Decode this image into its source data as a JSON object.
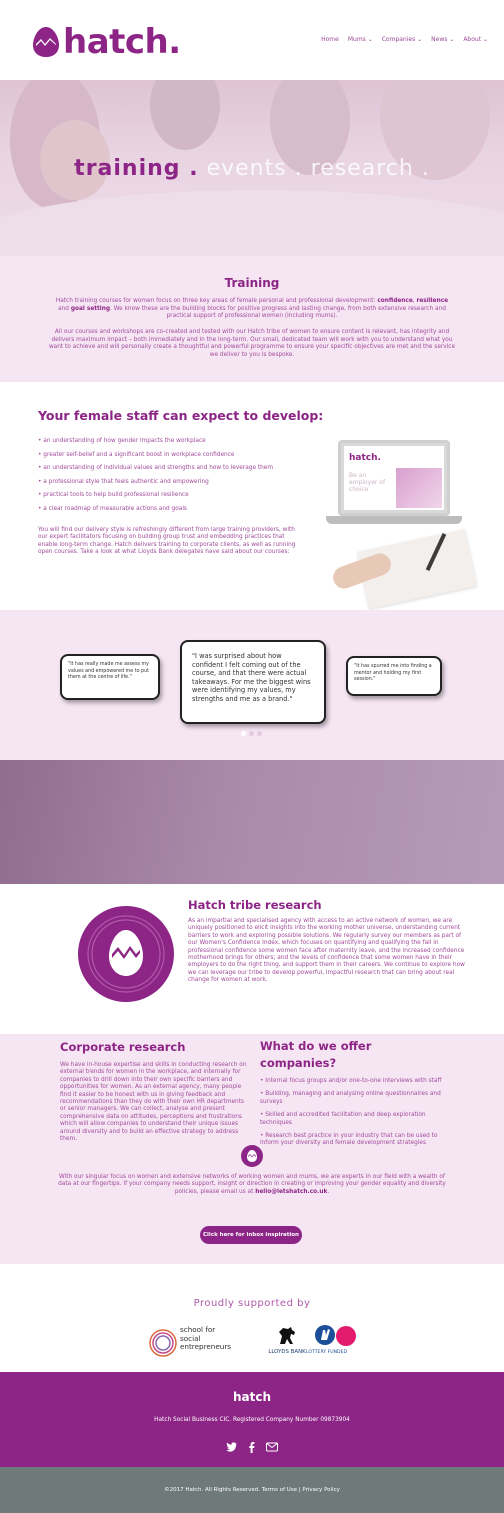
{
  "header": {
    "brand": "hatch.",
    "nav": [
      "Home",
      "Mums ⌄",
      "Companies ⌄",
      "News ⌄",
      "About ⌄"
    ]
  },
  "hero": {
    "word1": "training .",
    "word2": "events . research ."
  },
  "training": {
    "title": "Training",
    "p1_a": "Hatch training courses for women focus on three key areas of female personal and professional development: ",
    "p1_b1": "confidence",
    "p1_c": ", ",
    "p1_b2": "resilience",
    "p1_d": " and ",
    "p1_b3": "goal setting",
    "p1_e": ". We know these are the building blocks for positive progress and lasting change, from both extensive research and practical support of professional women (including mums).",
    "p2": "All our courses and workshops are co-created and tested with our Hatch tribe of women to ensure content is relevant, has integrity and delivers maximum impact – both immediately and in the long-term. Our small, dedicated team will work with you to understand what you want to achieve and will personally create a thoughtful and powerful programme to ensure your specific objectives are met and the service we deliver to you is bespoke."
  },
  "develop": {
    "title": "Your female staff can expect to develop:",
    "items": [
      "• an understanding of how gender impacts the workplace",
      "• greater self-belief and a significant boost in workplace confidence",
      "• an understanding of individual values and strengths and how to leverage them",
      "• a professional style that feels authentic and empowering",
      "• practical tools to help build professional resilience",
      "• a clear roadmap of measurable actions and goals"
    ],
    "paragraph": "You will find our delivery style is refreshingly different from large training providers, with our expert facilitators focusing on building group trust and embedding practices that enable long-term change. Hatch delivers training to corporate clients, as well as running open courses. Take a look at what Lloyds Bank delegates have said about our courses:",
    "laptop_brand": "hatch.",
    "laptop_text": "Be an employer of choice"
  },
  "testimonials": {
    "left": "\"It has really made me assess my values and empowered me to put them at the centre of life.\"",
    "center": "\"I was surprised about how confident I felt coming out of the course, and that there were actual takeaways. For me the biggest wins were identifying my values, my strengths and me as a brand.\"",
    "right": "\"It has spurred me into finding a mentor and holding my first session.\""
  },
  "research": {
    "title": "Hatch tribe research",
    "paragraph": "As an impartial and specialised agency with access to an active network of women, we are uniquely positioned to elicit insights into the working mother universe, understanding current barriers to work and exploring possible solutions. We regularly survey our members as part of our Women's Confidence Index, which focuses on quantifying and qualifying the fall in professional confidence some women face after maternity leave, and the increased confidence motherhood brings for others; and the levels of confidence that some women have in their employers to do the right thing, and support them in their careers. We continue to explore how we can leverage our tribe to develop powerful, impactful research that can bring about real change for women at work."
  },
  "corporate": {
    "title": "Corporate research",
    "paragraph": "We have in-house expertise and skills in conducting research on external trends for women in the workplace, and internally for companies to drill down into their own specific barriers and opportunities for women. As an external agency, many people find it easier to be honest with us in giving feedback and recommendations than they do with their own HR departments or senior managers. We can collect, analyse and present comprehensive data on attitudes, perceptions and frustrations which will allow companies to understand their unique issues around diversity and to build an effective strategy to address them.",
    "offer_title": "What do we offer companies?",
    "offers": [
      "• Internal focus groups and/or one-to-one interviews with staff",
      "• Building, managing and analysing online questionnaires and surveys",
      "• Skilled and accredited facilitation and deep exploration techniques",
      "• Research best practice in your industry that can be used to inform your diversity and female development strategies"
    ],
    "footer_text": "With our singular focus on women and extensive networks of working women and mums, we are experts in our field with a wealth of data at our fingertips. If your company needs support, insight or direction in creating or improving your gender equality and diversity policies, please email us at ",
    "email": "hello@letshatch.co.uk",
    "footer_end": ".",
    "button": "Click here for inbox inspiration"
  },
  "support": {
    "title": "Proudly supported by",
    "sse_line1": "school for",
    "sse_line2": "social",
    "sse_line3": "entrepreneurs",
    "lloyds": "LLOYDS BANK",
    "lottery": "LOTTERY FUNDED"
  },
  "footer": {
    "brand": "hatch",
    "registration": "Hatch Social Business CIC. Registered Company Number 09873904",
    "copyright": "©2017 Hatch. All Rights Reserved.  Terms of Use | Privacy Policy"
  },
  "colors": {
    "brand_purple": "#8d2586",
    "light_pink": "#f6e6f4",
    "footer_grey": "#6f7a78"
  }
}
